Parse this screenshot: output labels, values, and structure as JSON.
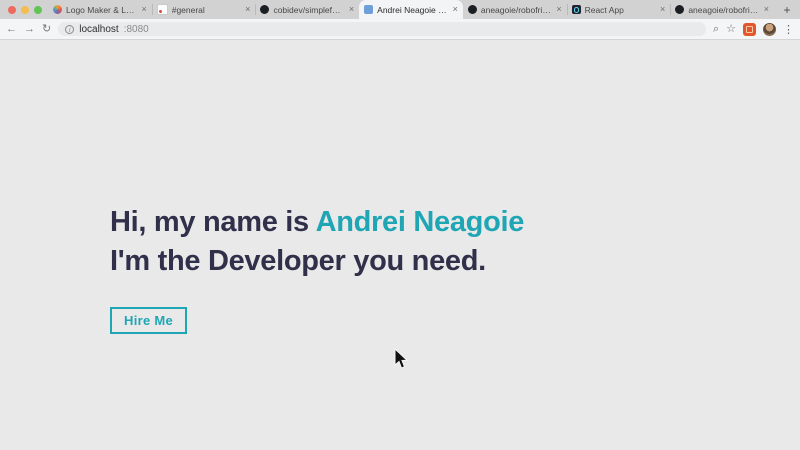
{
  "browser": {
    "close_glyph": "×",
    "new_tab_glyph": "+",
    "tabs": [
      {
        "title": "Logo Maker & Logo Creati",
        "favicon": "logo-maker-icon"
      },
      {
        "title": "#general",
        "favicon": "slack-icon"
      },
      {
        "title": "cobidev/simplefolio: A cle",
        "favicon": "github-icon"
      },
      {
        "title": "Andrei Neagoie | Develope",
        "favicon": "site-icon",
        "active": true
      },
      {
        "title": "aneagoie/robofriends: Tut",
        "favicon": "github-icon"
      },
      {
        "title": "React App",
        "favicon": "react-icon"
      },
      {
        "title": "aneagoie/robofriends: Tut",
        "favicon": "github-icon"
      }
    ],
    "toolbar": {
      "back_glyph": "←",
      "forward_glyph": "→",
      "reload_glyph": "↻",
      "info_glyph": "i",
      "url_host": "localhost",
      "url_port": ":8080",
      "zoom_glyph": "⌕",
      "star_glyph": "☆",
      "menu_glyph": "⋮"
    }
  },
  "page": {
    "heading_prefix": "Hi, my name is ",
    "heading_name": "Andrei Neagoie",
    "heading_line2": "I'm the Developer you need.",
    "cta_label": "Hire Me"
  },
  "colors": {
    "accent_teal": "#1fa6b4",
    "heading_dark": "#30304a",
    "page_background": "#e9e9ea"
  }
}
